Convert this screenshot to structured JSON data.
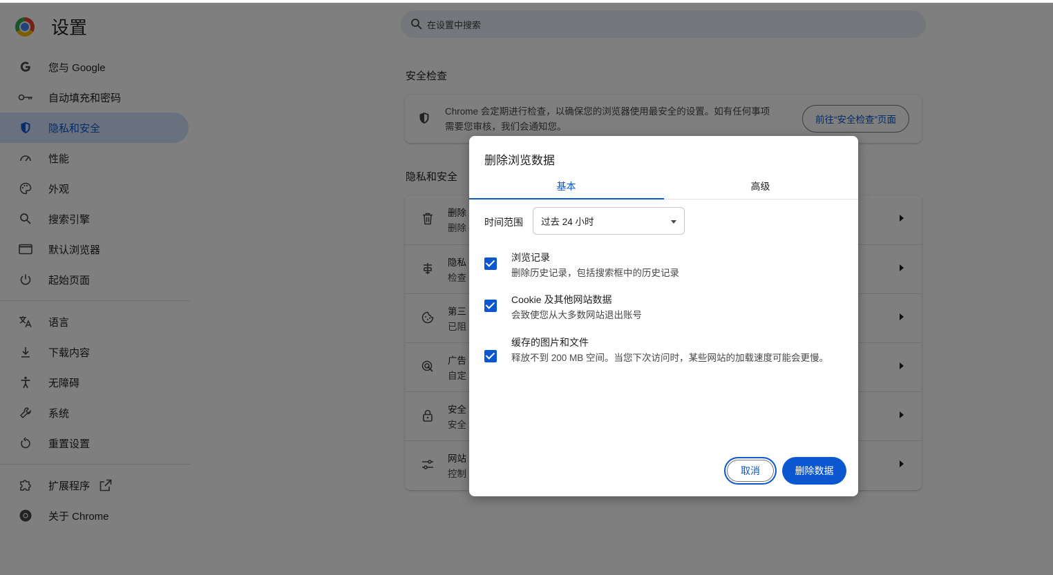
{
  "app": {
    "title": "设置"
  },
  "search": {
    "placeholder": "在设置中搜索"
  },
  "sidebar": {
    "items": [
      {
        "label": "您与 Google",
        "icon": "google-g-icon"
      },
      {
        "label": "自动填充和密码",
        "icon": "key-icon"
      },
      {
        "label": "隐私和安全",
        "icon": "shield-icon",
        "active": true
      },
      {
        "label": "性能",
        "icon": "speedometer-icon"
      },
      {
        "label": "外观",
        "icon": "palette-icon"
      },
      {
        "label": "搜索引擎",
        "icon": "search-icon"
      },
      {
        "label": "默认浏览器",
        "icon": "browser-window-icon"
      },
      {
        "label": "起始页面",
        "icon": "power-icon"
      },
      {
        "label": "语言",
        "icon": "translate-icon"
      },
      {
        "label": "下载内容",
        "icon": "download-icon"
      },
      {
        "label": "无障碍",
        "icon": "accessibility-icon"
      },
      {
        "label": "系统",
        "icon": "wrench-icon"
      },
      {
        "label": "重置设置",
        "icon": "reset-icon"
      },
      {
        "label": "扩展程序",
        "icon": "puzzle-icon"
      },
      {
        "label": "关于 Chrome",
        "icon": "chrome-icon"
      }
    ]
  },
  "safety_check": {
    "heading": "安全检查",
    "text": "Chrome 会定期进行检查，以确保您的浏览器使用最安全的设置。如有任何事项需要您审核，我们会通知您。",
    "button": "前往“安全检查”页面"
  },
  "privacy": {
    "heading": "隐私和安全",
    "rows": [
      {
        "title": "删除",
        "sub": "删除"
      },
      {
        "title": "隐私",
        "sub": "检查"
      },
      {
        "title": "第三",
        "sub": "已阻"
      },
      {
        "title": "广告",
        "sub": "自定"
      },
      {
        "title": "安全",
        "sub": "安全"
      },
      {
        "title": "网站",
        "sub": "控制"
      }
    ]
  },
  "dialog": {
    "title": "删除浏览数据",
    "tabs": [
      "基本",
      "高级"
    ],
    "time_range_label": "时间范围",
    "time_range_value": "过去 24 小时",
    "options": [
      {
        "title": "浏览记录",
        "sub": "删除历史记录，包括搜索框中的历史记录",
        "checked": true
      },
      {
        "title": "Cookie 及其他网站数据",
        "sub": "会致使您从大多数网站退出账号",
        "checked": true
      },
      {
        "title": "缓存的图片和文件",
        "sub": "释放不到 200 MB 空间。当您下次访问时，某些网站的加载速度可能会更慢。",
        "checked": true
      }
    ],
    "cancel": "取消",
    "confirm": "删除数据"
  },
  "colors": {
    "accent": "#0b57d0",
    "active_bg": "#d3e3fd",
    "scrim": "rgba(0,0,0,0.5)"
  }
}
